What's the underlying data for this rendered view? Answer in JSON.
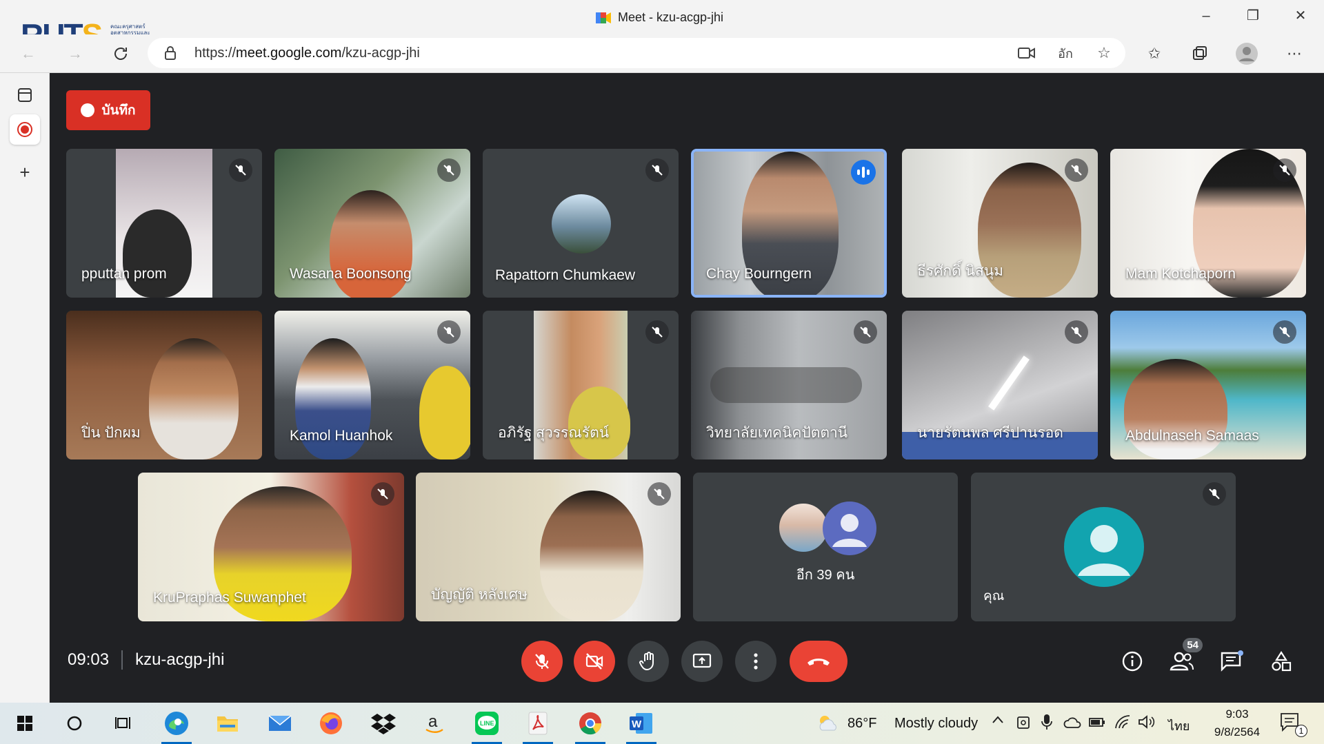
{
  "browser": {
    "tab_title": "Meet - kzu-acgp-jhi",
    "url_prefix": "https://",
    "url_host": "meet.google.com",
    "url_path": "/kzu-acgp-jhi",
    "logo_text_a": "RUT",
    "logo_text_b": "S",
    "logo_sub": "คณะครุศาสตร์อุตสาหกรรมและเทคโนโลยี",
    "translate_label": "อัก"
  },
  "meet": {
    "record_label": "บันทึก",
    "time": "09:03",
    "meeting_code": "kzu-acgp-jhi",
    "people_count": "54",
    "colors": {
      "bg": "#202124",
      "tile": "#3c4043",
      "red": "#ea4335",
      "accent": "#8ab4f8"
    },
    "participants": [
      {
        "name": "pputtan prom",
        "muted": true
      },
      {
        "name": "Wasana Boonsong",
        "muted": true
      },
      {
        "name": "Rapattorn Chumkaew",
        "muted": true
      },
      {
        "name": "Chay Bourngern",
        "muted": false,
        "speaking": true
      },
      {
        "name": "ธีรศักดิ์ นิสนุม",
        "muted": true
      },
      {
        "name": "Mam Kotchaporn",
        "muted": true
      },
      {
        "name": "ปิ่น ปักผม",
        "muted": false
      },
      {
        "name": "Kamol Huanhok",
        "muted": true
      },
      {
        "name": "อภิรัฐ สุวรรณรัตน์",
        "muted": true
      },
      {
        "name": "วิทยาลัยเทคนิคปัตตานี",
        "muted": true
      },
      {
        "name": "นายรัตนพล ศรีปานรอด",
        "muted": true
      },
      {
        "name": "Abdulnaseh Samaas",
        "muted": true
      },
      {
        "name": "KruPraphas Suwanphet",
        "muted": true
      },
      {
        "name": "บัญญัติ หลังเศษ",
        "muted": true
      },
      {
        "name": "อีก 39 คน",
        "muted": false
      },
      {
        "name": "คุณ",
        "muted": true
      }
    ]
  },
  "taskbar": {
    "temperature": "86°F",
    "weather": "Mostly cloudy",
    "lang": "ไทย",
    "clock_time": "9:03",
    "clock_date": "9/8/2564",
    "notif_count": "1"
  }
}
